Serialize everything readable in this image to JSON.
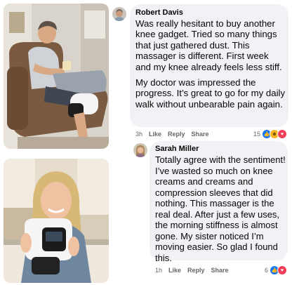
{
  "comments": [
    {
      "author": "Robert Davis",
      "paragraphs": [
        "Was really hesitant to buy another knee gadget. Tried so many things that just gathered dust. This massager is different. First week and my knee already feels less stiff.",
        "My doctor was impressed the progress. It’s great to go for my daily walk without unbearable pain again."
      ],
      "time": "3h",
      "like_label": "Like",
      "reply_label": "Reply",
      "share_label": "Share",
      "reaction_count": "15",
      "reactions": [
        "like",
        "haha",
        "heart"
      ]
    },
    {
      "author": "Sarah Miller",
      "paragraphs": [
        "Totally agree with the sentiment! I’ve wasted so much on knee creams and creams and compression sleeves that did nothing. This massager is the real deal. After just a  few uses, the morning stiffness is almost gone. My sister noticed I’m moving easier. So glad I found this."
      ],
      "time": "1h",
      "like_label": "Like",
      "reply_label": "Reply",
      "share_label": "Share",
      "reaction_count": "6",
      "reactions": [
        "like",
        "heart"
      ]
    }
  ],
  "colors": {
    "bubble": "#f0f2f5",
    "text": "#050505",
    "secondary_text": "#65676b",
    "like_blue": "#1877f2",
    "heart_red": "#f33e58",
    "haha_yellow": "#f7b125"
  },
  "photos": [
    {
      "subject": "man in recliner wearing knee massager"
    },
    {
      "subject": "smiling woman holding knee massager in kitchen"
    }
  ]
}
